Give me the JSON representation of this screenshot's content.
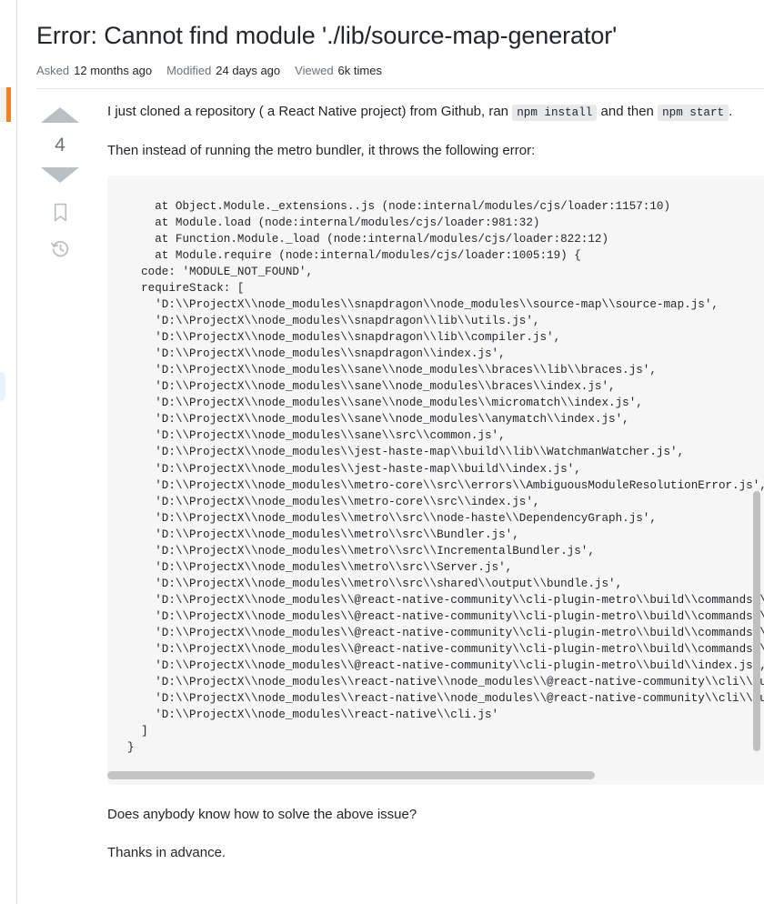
{
  "question": {
    "title": "Error: Cannot find module './lib/source-map-generator'",
    "stats": [
      {
        "label": "Asked",
        "value": "12 months ago"
      },
      {
        "label": "Modified",
        "value": "24 days ago"
      },
      {
        "label": "Viewed",
        "value": "6k times"
      }
    ]
  },
  "vote": {
    "up_icon": "upvote-arrow-icon",
    "down_icon": "downvote-arrow-icon",
    "count": "4",
    "bookmark_icon": "bookmark-icon",
    "history_icon": "history-icon"
  },
  "body": {
    "intro_part1": "I just cloned a repository ( a React Native project) from Github, ran ",
    "intro_code1": "npm install",
    "intro_part2": " and then ",
    "intro_code2": "npm start",
    "intro_part3": ".",
    "then_text": "Then instead of running the metro bundler, it throws the following error:",
    "ask_text": "Does anybody know how to solve the above issue?",
    "thanks_text": "Thanks in advance."
  },
  "code_block": {
    "lines": [
      "    at Object.Module._extensions..js (node:internal/modules/cjs/loader:1157:10)",
      "    at Module.load (node:internal/modules/cjs/loader:981:32)",
      "    at Function.Module._load (node:internal/modules/cjs/loader:822:12)",
      "    at Module.require (node:internal/modules/cjs/loader:1005:19) {",
      "  code: 'MODULE_NOT_FOUND',",
      "  requireStack: [",
      "    'D:\\\\ProjectX\\\\node_modules\\\\snapdragon\\\\node_modules\\\\source-map\\\\source-map.js',",
      "    'D:\\\\ProjectX\\\\node_modules\\\\snapdragon\\\\lib\\\\utils.js',",
      "    'D:\\\\ProjectX\\\\node_modules\\\\snapdragon\\\\lib\\\\compiler.js',",
      "    'D:\\\\ProjectX\\\\node_modules\\\\snapdragon\\\\index.js',",
      "    'D:\\\\ProjectX\\\\node_modules\\\\sane\\\\node_modules\\\\braces\\\\lib\\\\braces.js',",
      "    'D:\\\\ProjectX\\\\node_modules\\\\sane\\\\node_modules\\\\braces\\\\index.js',",
      "    'D:\\\\ProjectX\\\\node_modules\\\\sane\\\\node_modules\\\\micromatch\\\\index.js',",
      "    'D:\\\\ProjectX\\\\node_modules\\\\sane\\\\node_modules\\\\anymatch\\\\index.js',",
      "    'D:\\\\ProjectX\\\\node_modules\\\\sane\\\\src\\\\common.js',",
      "    'D:\\\\ProjectX\\\\node_modules\\\\jest-haste-map\\\\build\\\\lib\\\\WatchmanWatcher.js',",
      "    'D:\\\\ProjectX\\\\node_modules\\\\jest-haste-map\\\\build\\\\index.js',",
      "    'D:\\\\ProjectX\\\\node_modules\\\\metro-core\\\\src\\\\errors\\\\AmbiguousModuleResolutionError.js',",
      "    'D:\\\\ProjectX\\\\node_modules\\\\metro-core\\\\src\\\\index.js',",
      "    'D:\\\\ProjectX\\\\node_modules\\\\metro\\\\src\\\\node-haste\\\\DependencyGraph.js',",
      "    'D:\\\\ProjectX\\\\node_modules\\\\metro\\\\src\\\\Bundler.js',",
      "    'D:\\\\ProjectX\\\\node_modules\\\\metro\\\\src\\\\IncrementalBundler.js',",
      "    'D:\\\\ProjectX\\\\node_modules\\\\metro\\\\src\\\\Server.js',",
      "    'D:\\\\ProjectX\\\\node_modules\\\\metro\\\\src\\\\shared\\\\output\\\\bundle.js',",
      "    'D:\\\\ProjectX\\\\node_modules\\\\@react-native-community\\\\cli-plugin-metro\\\\build\\\\commands\\\\bundle.js',",
      "    'D:\\\\ProjectX\\\\node_modules\\\\@react-native-community\\\\cli-plugin-metro\\\\build\\\\commands\\\\ramBundle.js',",
      "    'D:\\\\ProjectX\\\\node_modules\\\\@react-native-community\\\\cli-plugin-metro\\\\build\\\\commands\\\\start.js',",
      "    'D:\\\\ProjectX\\\\node_modules\\\\@react-native-community\\\\cli-plugin-metro\\\\build\\\\commands\\\\index.js',",
      "    'D:\\\\ProjectX\\\\node_modules\\\\@react-native-community\\\\cli-plugin-metro\\\\build\\\\index.js',",
      "    'D:\\\\ProjectX\\\\node_modules\\\\react-native\\\\node_modules\\\\@react-native-community\\\\cli\\\\build\\\\index.js',",
      "    'D:\\\\ProjectX\\\\node_modules\\\\react-native\\\\node_modules\\\\@react-native-community\\\\cli\\\\build\\\\cliEntry.js',",
      "    'D:\\\\ProjectX\\\\node_modules\\\\react-native\\\\cli.js'",
      "  ]",
      "}"
    ],
    "vscrollbar": "code-vertical-scrollbar",
    "hscrollbar": "code-horizontal-scrollbar"
  },
  "colors": {
    "accent_orange": "#f48024",
    "code_bg": "#f6f6f6",
    "inline_code_bg": "#e7e9eb",
    "muted_text": "#6a737c",
    "arrow_gray": "#babfc4"
  }
}
